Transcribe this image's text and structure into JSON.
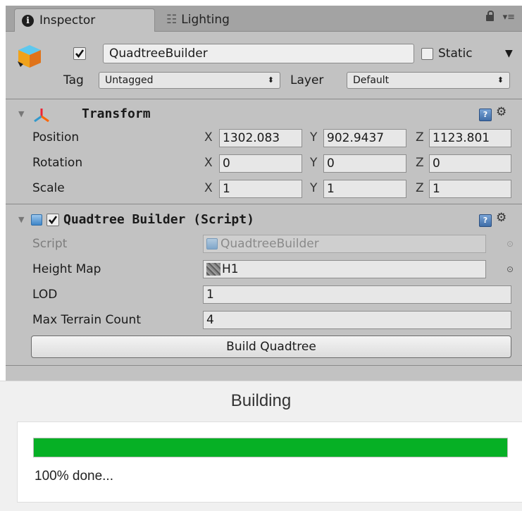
{
  "tabs": {
    "inspector": "Inspector",
    "lighting": "Lighting"
  },
  "header": {
    "active": true,
    "name": "QuadtreeBuilder",
    "static_label": "Static",
    "static_checked": false,
    "tag_label": "Tag",
    "tag_value": "Untagged",
    "layer_label": "Layer",
    "layer_value": "Default"
  },
  "transform": {
    "title": "Transform",
    "rows": [
      {
        "label": "Position",
        "x": "1302.083",
        "y": "902.9437",
        "z": "1123.801"
      },
      {
        "label": "Rotation",
        "x": "0",
        "y": "0",
        "z": "0"
      },
      {
        "label": "Scale",
        "x": "1",
        "y": "1",
        "z": "1"
      }
    ],
    "axes": {
      "x": "X",
      "y": "Y",
      "z": "Z"
    }
  },
  "quadtree": {
    "title": "Quadtree Builder (Script)",
    "enabled": true,
    "script_label": "Script",
    "script_value": "QuadtreeBuilder",
    "heightmap_label": "Height Map",
    "heightmap_value": "H1",
    "lod_label": "LOD",
    "lod_value": "1",
    "max_terrain_label": "Max Terrain Count",
    "max_terrain_value": "4",
    "build_button": "Build Quadtree"
  },
  "progress": {
    "title": "Building",
    "percent": 100,
    "status": "100% done..."
  },
  "colors": {
    "progress_fill": "#06b025",
    "panel_bg": "#c2c2c2"
  }
}
